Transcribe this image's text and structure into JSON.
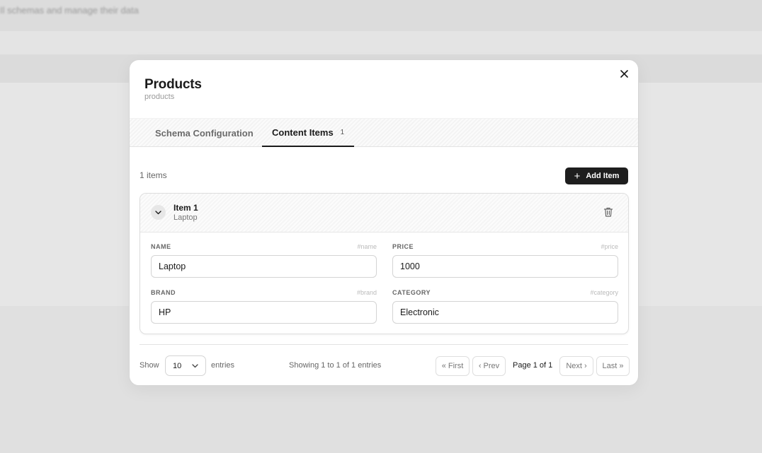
{
  "background": {
    "header_text": "Il schemas and manage their data"
  },
  "modal": {
    "title": "Products",
    "subtitle": "products",
    "close_icon": "close-icon"
  },
  "tabs": [
    {
      "label": "Schema Configuration",
      "active": false
    },
    {
      "label": "Content Items",
      "badge": "1",
      "active": true
    }
  ],
  "toolbar": {
    "items_count": "1 items",
    "add_label": "Add Item"
  },
  "item": {
    "title": "Item 1",
    "subtitle": "Laptop",
    "fields": [
      {
        "label": "NAME",
        "key": "#name",
        "value": "Laptop"
      },
      {
        "label": "PRICE",
        "key": "#price",
        "value": "1000"
      },
      {
        "label": "BRAND",
        "key": "#brand",
        "value": "HP"
      },
      {
        "label": "CATEGORY",
        "key": "#category",
        "value": "Electronic"
      }
    ]
  },
  "pagination": {
    "show_label": "Show",
    "page_size": "10",
    "entries_label": "entries",
    "showing_text": "Showing 1 to 1 of 1 entries",
    "first": "« First",
    "prev": "‹ Prev",
    "page_info": "Page 1 of 1",
    "next": "Next ›",
    "last": "Last »"
  },
  "colors": {
    "overlay": "#e2e2e2",
    "primary_button": "#1e1e1e",
    "active_tab_underline": "#1a1a1a"
  }
}
